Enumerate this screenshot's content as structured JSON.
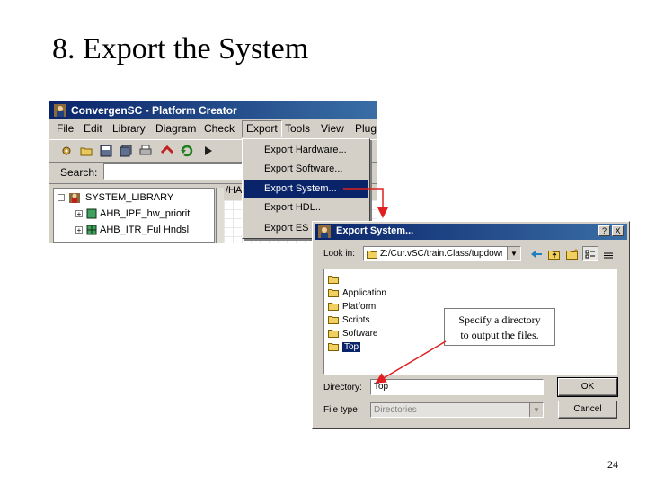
{
  "slide": {
    "title": "8. Export the System",
    "page_number": "24"
  },
  "platform_creator": {
    "window_title": "ConvergenSC - Platform Creator",
    "menus": [
      "File",
      "Edit",
      "Library",
      "Diagram",
      "Check",
      "Export",
      "Tools",
      "View",
      "Plug"
    ],
    "open_menu": "Export",
    "search_label": "Search:",
    "search_value": "",
    "tree": {
      "root": "SYSTEM_LIBRARY",
      "items": [
        "AHB_IPE_hw_priorit",
        "AHB_ITR_Ful Hndsl"
      ]
    },
    "tab_label": "/HA"
  },
  "export_menu": {
    "items": [
      "Export Hardware...",
      "Export Software...",
      "Export System...",
      "Export HDL..",
      "Export ES"
    ],
    "selected": "Export System..."
  },
  "export_dialog": {
    "title": "Export System...",
    "look_in_label": "Look in:",
    "look_in_value": "Z:/Cur.vSC/train.Class/tupdown/",
    "folders": [
      "Application",
      "Platform",
      "Scripts",
      "Software",
      "Top"
    ],
    "selected_folder": "Top",
    "directory_label": "Directory:",
    "directory_value": "Top",
    "file_type_label": "File type",
    "file_type_value": "Directories",
    "ok_label": "OK",
    "cancel_label": "Cancel",
    "window_buttons": [
      "?",
      "X"
    ]
  },
  "annotation": {
    "line1": "Specify a directory",
    "line2": "to output the files.",
    "color": "#e02020"
  }
}
